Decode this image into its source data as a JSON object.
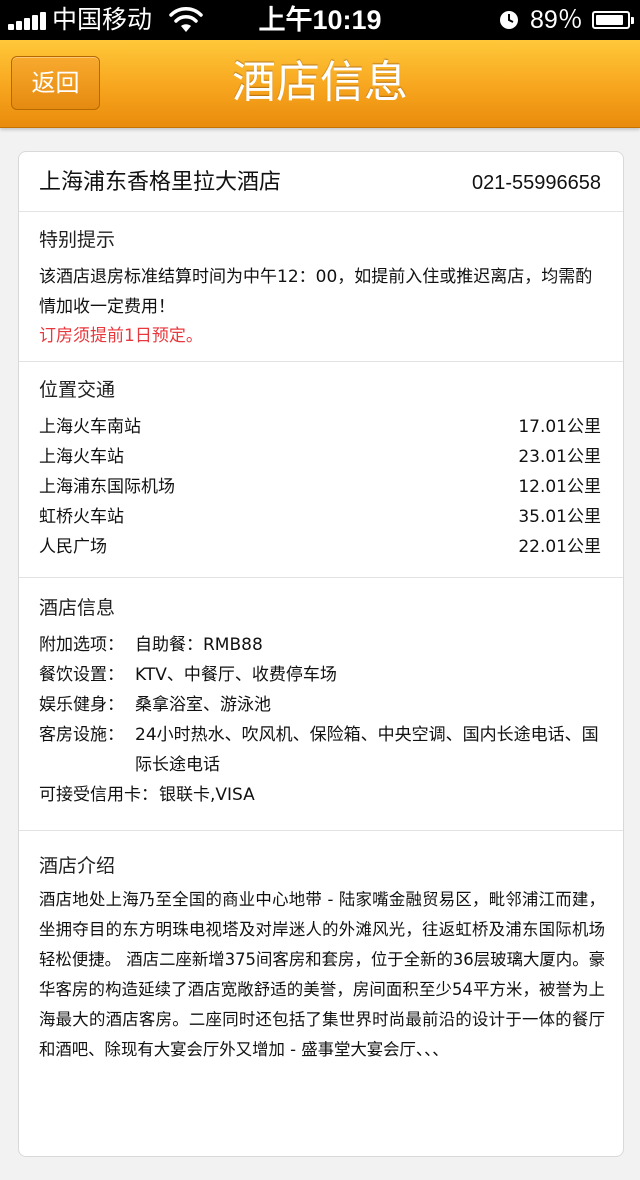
{
  "status_bar": {
    "carrier": "中国移动",
    "time": "上午10:19",
    "battery_percent": "89％",
    "battery_level": 0.89,
    "icons": [
      "signal-bars-icon",
      "wifi-icon",
      "alarm-clock-icon",
      "battery-icon"
    ]
  },
  "nav": {
    "back_label": "返回",
    "title": "酒店信息",
    "accent_color": "#f7a51e"
  },
  "hotel": {
    "name": "上海浦东香格里拉大酒店",
    "phone": "021-55996658"
  },
  "notice": {
    "title": "特别提示",
    "text": "该酒店退房标准结算时间为中午12：00，如提前入住或推迟离店，均需酌情加收一定费用！",
    "warning": "订房须提前1日预定。",
    "warning_color": "#e8383d"
  },
  "location": {
    "title": "位置交通",
    "items": [
      {
        "place": "上海火车南站",
        "distance": "17.01公里"
      },
      {
        "place": "上海火车站",
        "distance": "23.01公里"
      },
      {
        "place": "上海浦东国际机场",
        "distance": "12.01公里"
      },
      {
        "place": "虹桥火车站",
        "distance": "35.01公里"
      },
      {
        "place": "人民广场",
        "distance": "22.01公里"
      }
    ]
  },
  "info": {
    "title": "酒店信息",
    "extras_label": "附加选项：",
    "extras_value": "自助餐：RMB88",
    "dining_label": "餐饮设置：",
    "dining_value": "KTV、中餐厅、收费停车场",
    "leisure_label": "娱乐健身：",
    "leisure_value": "桑拿浴室、游泳池",
    "room_label": "客房设施：",
    "room_value": "24小时热水、吹风机、保险箱、中央空调、国内长途电话、国际长途电话",
    "cards_label": "可接受信用卡：",
    "cards_value": "银联卡,VISA"
  },
  "intro": {
    "title": "酒店介绍",
    "text": "酒店地处上海乃至全国的商业中心地带 - 陆家嘴金融贸易区，毗邻浦江而建，坐拥夺目的东方明珠电视塔及对岸迷人的外滩风光，往返虹桥及浦东国际机场轻松便捷。 酒店二座新增375间客房和套房，位于全新的36层玻璃大厦内。豪华客房的构造延续了酒店宽敞舒适的美誉，房间面积至少54平方米，被誉为上海最大的酒店客房。二座同时还包括了集世界时尚最前沿的设计于一体的餐厅和酒吧、除现有大宴会厅外又增加 - 盛事堂大宴会厅、、、"
  }
}
